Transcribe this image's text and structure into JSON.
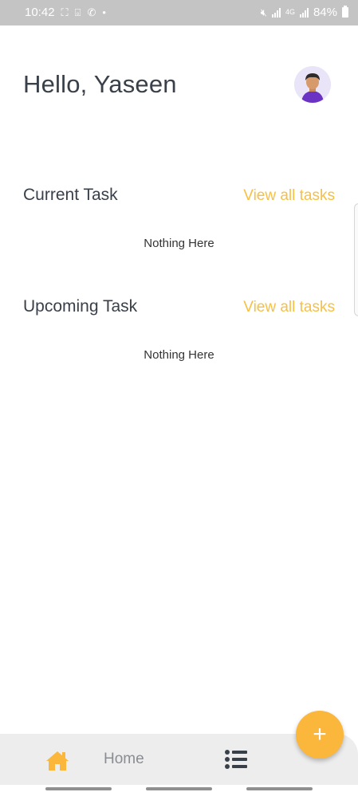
{
  "status_bar": {
    "time": "10:42",
    "battery": "84%",
    "network": "4G"
  },
  "header": {
    "greeting": "Hello, Yaseen"
  },
  "sections": {
    "current": {
      "title": "Current Task",
      "view_all": "View all tasks",
      "empty": "Nothing Here"
    },
    "upcoming": {
      "title": "Upcoming Task",
      "view_all": "View all tasks",
      "empty": "Nothing Here"
    }
  },
  "bottom_nav": {
    "home_label": "Home",
    "fab_symbol": "+"
  },
  "colors": {
    "accent": "#f6c046",
    "fab": "#fbb63c",
    "status_bar": "#c4c4c4",
    "text": "#3a4049"
  }
}
